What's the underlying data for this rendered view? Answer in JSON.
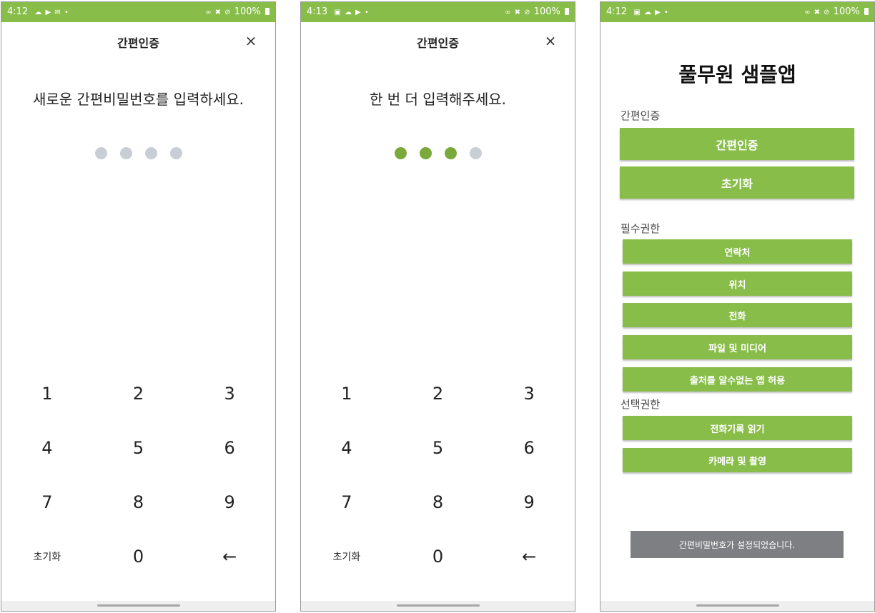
{
  "screens": [
    {
      "status": {
        "time": "4:12",
        "icons_left": "☁ ▶ ✉ •",
        "icons_right": "∞ ✖ ⊘",
        "battery": "100%"
      },
      "header": {
        "title": "간편인증",
        "close": "×"
      },
      "prompt": "새로운 간편비밀번호를 입력하세요.",
      "pin_entered": 0,
      "pin_length": 4,
      "keypad": [
        [
          "1",
          "2",
          "3"
        ],
        [
          "4",
          "5",
          "6"
        ],
        [
          "7",
          "8",
          "9"
        ],
        [
          "초기화",
          "0",
          "←"
        ]
      ]
    },
    {
      "status": {
        "time": "4:13",
        "icons_left": "▣ ☁ ▶ •",
        "icons_right": "∞ ✖ ⊘",
        "battery": "100%"
      },
      "header": {
        "title": "간편인증",
        "close": "×"
      },
      "prompt": "한 번 더 입력해주세요.",
      "pin_entered": 3,
      "pin_length": 4,
      "keypad": [
        [
          "1",
          "2",
          "3"
        ],
        [
          "4",
          "5",
          "6"
        ],
        [
          "7",
          "8",
          "9"
        ],
        [
          "초기화",
          "0",
          "←"
        ]
      ]
    },
    {
      "status": {
        "time": "4:12",
        "icons_left": "▣ ☁ ▶ •",
        "icons_right": "∞ ✖ ⊘",
        "battery": "100%"
      },
      "app_title": "풀무원 샘플앱",
      "auth_section": {
        "label": "간편인증",
        "buttons": [
          "간편인증",
          "초기화"
        ]
      },
      "required_section": {
        "label": "필수권한",
        "buttons": [
          "연락처",
          "위치",
          "전화",
          "파일 및 미디어",
          "출처를 알수없는 앱 허용"
        ]
      },
      "optional_section": {
        "label": "선택권한",
        "buttons": [
          "전화기록 읽기",
          "카메라 및 촬영"
        ]
      },
      "toast": "간편비밀번호가 설정되었습니다."
    }
  ],
  "colors": {
    "accent": "#88bd49",
    "dot_filled": "#7ba83a",
    "dot_empty": "#c9ced6",
    "toast_bg": "#7d7f82"
  }
}
